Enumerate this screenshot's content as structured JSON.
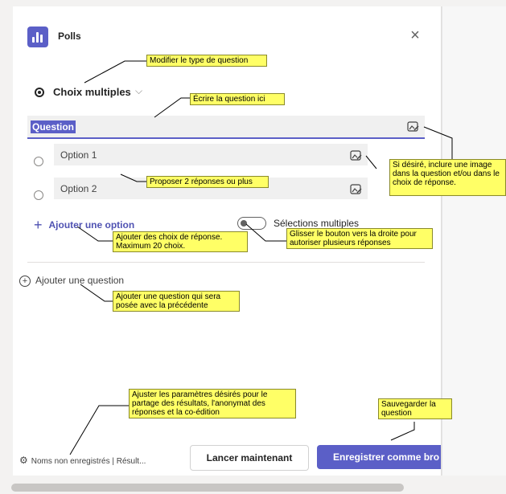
{
  "app": {
    "title": "Polls",
    "close_icon": "close-icon"
  },
  "question_type": {
    "label": "Choix multiples"
  },
  "question": {
    "value": "Question"
  },
  "options": [
    {
      "label": "Option 1"
    },
    {
      "label": "Option 2"
    }
  ],
  "add_option_label": "Ajouter une option",
  "multi_select_label": "Sélections multiples",
  "add_question_label": "Ajouter une question",
  "footer": {
    "settings_label": "Noms non enregistrés | Résult...",
    "launch_label": "Lancer maintenant",
    "save_label": "Enregistrer comme bro"
  },
  "annotations": {
    "type": "Modifier le type de question",
    "write": "Écrire la question ici",
    "image": "Si désiré, inclure une image dans la question et/ou dans le choix de réponse.",
    "propose": "Proposer 2 réponses ou plus",
    "add_choice": "Ajouter des choix de réponse. Maximum 20 choix.",
    "toggle": "Glisser le bouton vers la droite pour autoriser plusieurs réponses",
    "add_question": "Ajouter une question qui sera posée avec la précédente",
    "settings": "Ajuster les paramètres désirés pour le partage des résultats, l'anonymat des réponses et la co-édition",
    "save": "Sauvegarder la question"
  },
  "colors": {
    "accent": "#5b5fc7",
    "note": "#ffff66"
  }
}
